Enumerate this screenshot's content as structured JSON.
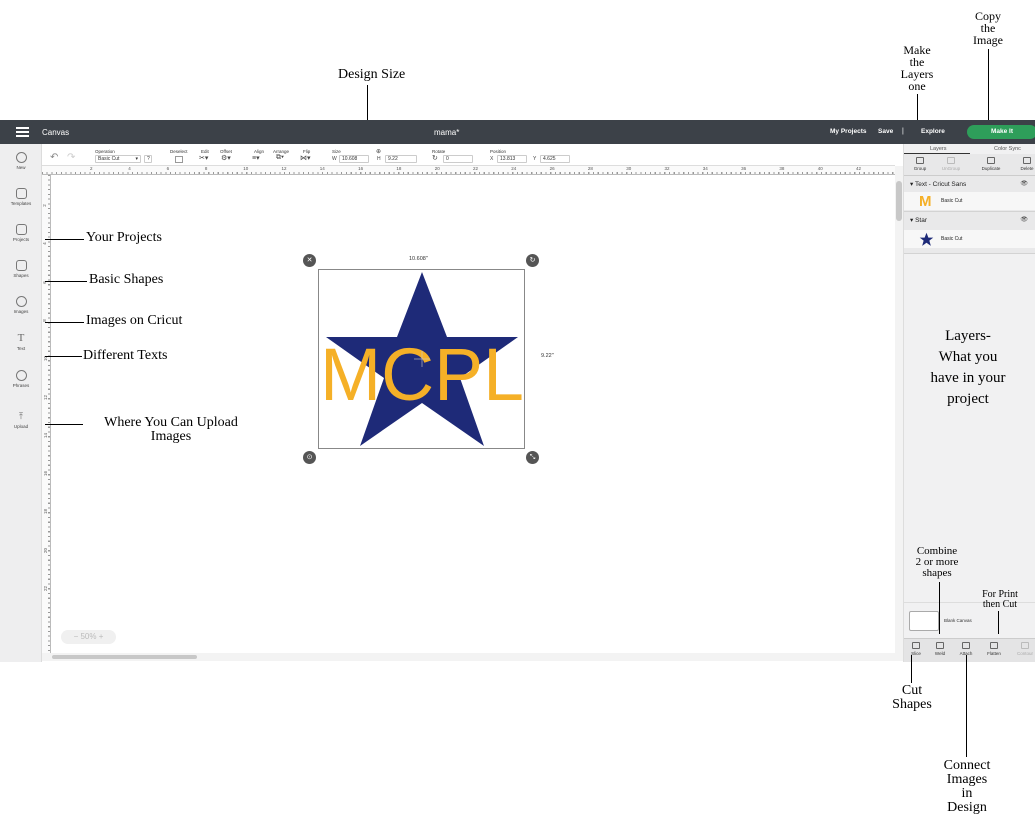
{
  "annotations": {
    "design_size": "Design Size",
    "make_layers_one": [
      "Make",
      "the",
      "Layers",
      "one"
    ],
    "copy_image": [
      "Copy",
      "the",
      "Image"
    ],
    "your_projects": "Your Projects",
    "basic_shapes": "Basic Shapes",
    "images_on_cricut": "Images on Cricut",
    "different_texts": "Different Texts",
    "upload_images": [
      "Where You Can Upload",
      "Images"
    ],
    "layers_what": [
      "Layers-",
      "What you",
      "have in your",
      "project"
    ],
    "combine": [
      "Combine",
      "2 or more",
      "shapes"
    ],
    "for_print": [
      "For Print",
      "then Cut"
    ],
    "cut_shapes": [
      "Cut",
      "Shapes"
    ],
    "connect": [
      "Connect",
      "Images",
      "in",
      "Design"
    ]
  },
  "topbar": {
    "title": "Canvas",
    "document": "mama*",
    "my_projects": "My Projects",
    "save": "Save",
    "separator": "|",
    "explore": "Explore",
    "make_it": "Make It"
  },
  "toolbar": {
    "operation_label": "Operation",
    "operation_value": "Basic Cut",
    "help": "?",
    "deselect": "Deselect",
    "edit": "Edit",
    "offset": "Offset",
    "align": "Align",
    "arrange": "Arrange",
    "flip": "Flip",
    "size_label": "Size",
    "w_label": "W",
    "w_value": "10.608",
    "h_label": "H",
    "h_value": "9.22",
    "rotate_label": "Rotate",
    "rotate_value": "0",
    "position_label": "Position",
    "x_label": "X",
    "x_value": "13.813",
    "y_label": "Y",
    "y_value": "4.625"
  },
  "sidebar": {
    "items": [
      {
        "label": "New",
        "icon": "plus-circle-icon"
      },
      {
        "label": "Templates",
        "icon": "shirt-icon"
      },
      {
        "label": "Projects",
        "icon": "clipboard-icon"
      },
      {
        "label": "Shapes",
        "icon": "shapes-icon"
      },
      {
        "label": "Images",
        "icon": "lightbulb-icon"
      },
      {
        "label": "Text",
        "icon": "text-icon"
      },
      {
        "label": "Phrases",
        "icon": "speech-bubble-icon"
      },
      {
        "label": "Upload",
        "icon": "upload-icon"
      }
    ]
  },
  "ruler": {
    "top": [
      "2",
      "4",
      "6",
      "8",
      "10",
      "12",
      "14",
      "16",
      "18",
      "20",
      "22",
      "24",
      "26",
      "28",
      "30",
      "32",
      "34",
      "36",
      "38",
      "40",
      "42"
    ],
    "left": [
      "2",
      "4",
      "6",
      "8",
      "10",
      "12",
      "14",
      "16",
      "18",
      "20",
      "22"
    ]
  },
  "canvas": {
    "dim_width": "10.608\"",
    "dim_height": "9.22\"",
    "design_text": "MCPL",
    "zoom": "50%",
    "zoom_minus": "−",
    "zoom_plus": "+"
  },
  "colors": {
    "star": "#1e2a78",
    "text": "#f5b027",
    "topbar": "#3c4148",
    "make_it": "#2e9e5a"
  },
  "right_panel": {
    "tab_layers": "Layers",
    "tab_color_sync": "Color Sync",
    "actions": [
      {
        "label": "Group",
        "enabled": true
      },
      {
        "label": "UnGroup",
        "enabled": false
      },
      {
        "label": "Duplicate",
        "enabled": true
      },
      {
        "label": "Delete",
        "enabled": true
      }
    ],
    "layers": [
      {
        "name": "Text - Cricut Sans",
        "item": "Basic Cut",
        "thumb": "M"
      },
      {
        "name": "Star",
        "item": "Basic Cut",
        "thumb": "star"
      }
    ],
    "blank_canvas": "Blank Canvas",
    "bottom_actions": [
      {
        "label": "Slice",
        "enabled": true
      },
      {
        "label": "Weld",
        "enabled": true
      },
      {
        "label": "Attach",
        "enabled": true
      },
      {
        "label": "Flatten",
        "enabled": true
      },
      {
        "label": "Contour",
        "enabled": false
      }
    ]
  }
}
